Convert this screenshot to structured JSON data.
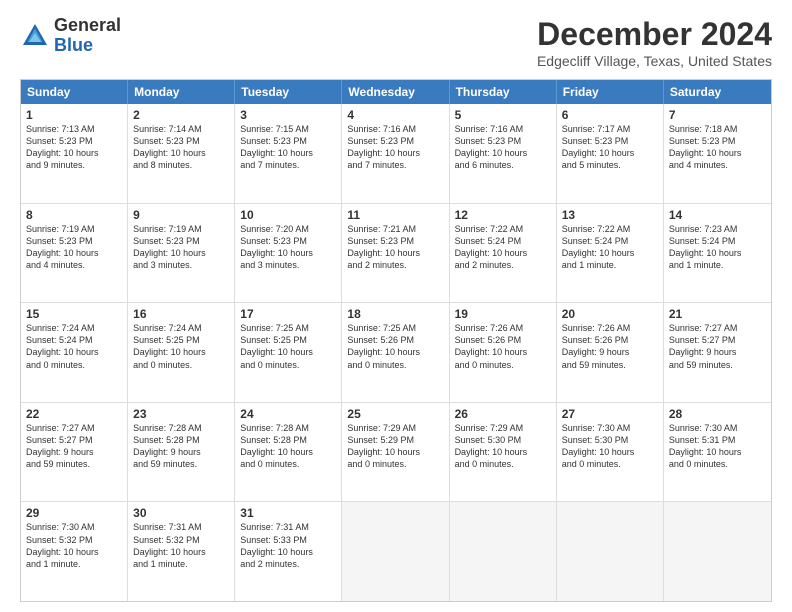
{
  "logo": {
    "general": "General",
    "blue": "Blue"
  },
  "title": "December 2024",
  "subtitle": "Edgecliff Village, Texas, United States",
  "headers": [
    "Sunday",
    "Monday",
    "Tuesday",
    "Wednesday",
    "Thursday",
    "Friday",
    "Saturday"
  ],
  "weeks": [
    [
      {
        "day": "1",
        "info": "Sunrise: 7:13 AM\nSunset: 5:23 PM\nDaylight: 10 hours\nand 9 minutes."
      },
      {
        "day": "2",
        "info": "Sunrise: 7:14 AM\nSunset: 5:23 PM\nDaylight: 10 hours\nand 8 minutes."
      },
      {
        "day": "3",
        "info": "Sunrise: 7:15 AM\nSunset: 5:23 PM\nDaylight: 10 hours\nand 7 minutes."
      },
      {
        "day": "4",
        "info": "Sunrise: 7:16 AM\nSunset: 5:23 PM\nDaylight: 10 hours\nand 7 minutes."
      },
      {
        "day": "5",
        "info": "Sunrise: 7:16 AM\nSunset: 5:23 PM\nDaylight: 10 hours\nand 6 minutes."
      },
      {
        "day": "6",
        "info": "Sunrise: 7:17 AM\nSunset: 5:23 PM\nDaylight: 10 hours\nand 5 minutes."
      },
      {
        "day": "7",
        "info": "Sunrise: 7:18 AM\nSunset: 5:23 PM\nDaylight: 10 hours\nand 4 minutes."
      }
    ],
    [
      {
        "day": "8",
        "info": "Sunrise: 7:19 AM\nSunset: 5:23 PM\nDaylight: 10 hours\nand 4 minutes."
      },
      {
        "day": "9",
        "info": "Sunrise: 7:19 AM\nSunset: 5:23 PM\nDaylight: 10 hours\nand 3 minutes."
      },
      {
        "day": "10",
        "info": "Sunrise: 7:20 AM\nSunset: 5:23 PM\nDaylight: 10 hours\nand 3 minutes."
      },
      {
        "day": "11",
        "info": "Sunrise: 7:21 AM\nSunset: 5:23 PM\nDaylight: 10 hours\nand 2 minutes."
      },
      {
        "day": "12",
        "info": "Sunrise: 7:22 AM\nSunset: 5:24 PM\nDaylight: 10 hours\nand 2 minutes."
      },
      {
        "day": "13",
        "info": "Sunrise: 7:22 AM\nSunset: 5:24 PM\nDaylight: 10 hours\nand 1 minute."
      },
      {
        "day": "14",
        "info": "Sunrise: 7:23 AM\nSunset: 5:24 PM\nDaylight: 10 hours\nand 1 minute."
      }
    ],
    [
      {
        "day": "15",
        "info": "Sunrise: 7:24 AM\nSunset: 5:24 PM\nDaylight: 10 hours\nand 0 minutes."
      },
      {
        "day": "16",
        "info": "Sunrise: 7:24 AM\nSunset: 5:25 PM\nDaylight: 10 hours\nand 0 minutes."
      },
      {
        "day": "17",
        "info": "Sunrise: 7:25 AM\nSunset: 5:25 PM\nDaylight: 10 hours\nand 0 minutes."
      },
      {
        "day": "18",
        "info": "Sunrise: 7:25 AM\nSunset: 5:26 PM\nDaylight: 10 hours\nand 0 minutes."
      },
      {
        "day": "19",
        "info": "Sunrise: 7:26 AM\nSunset: 5:26 PM\nDaylight: 10 hours\nand 0 minutes."
      },
      {
        "day": "20",
        "info": "Sunrise: 7:26 AM\nSunset: 5:26 PM\nDaylight: 9 hours\nand 59 minutes."
      },
      {
        "day": "21",
        "info": "Sunrise: 7:27 AM\nSunset: 5:27 PM\nDaylight: 9 hours\nand 59 minutes."
      }
    ],
    [
      {
        "day": "22",
        "info": "Sunrise: 7:27 AM\nSunset: 5:27 PM\nDaylight: 9 hours\nand 59 minutes."
      },
      {
        "day": "23",
        "info": "Sunrise: 7:28 AM\nSunset: 5:28 PM\nDaylight: 9 hours\nand 59 minutes."
      },
      {
        "day": "24",
        "info": "Sunrise: 7:28 AM\nSunset: 5:28 PM\nDaylight: 10 hours\nand 0 minutes."
      },
      {
        "day": "25",
        "info": "Sunrise: 7:29 AM\nSunset: 5:29 PM\nDaylight: 10 hours\nand 0 minutes."
      },
      {
        "day": "26",
        "info": "Sunrise: 7:29 AM\nSunset: 5:30 PM\nDaylight: 10 hours\nand 0 minutes."
      },
      {
        "day": "27",
        "info": "Sunrise: 7:30 AM\nSunset: 5:30 PM\nDaylight: 10 hours\nand 0 minutes."
      },
      {
        "day": "28",
        "info": "Sunrise: 7:30 AM\nSunset: 5:31 PM\nDaylight: 10 hours\nand 0 minutes."
      }
    ],
    [
      {
        "day": "29",
        "info": "Sunrise: 7:30 AM\nSunset: 5:32 PM\nDaylight: 10 hours\nand 1 minute."
      },
      {
        "day": "30",
        "info": "Sunrise: 7:31 AM\nSunset: 5:32 PM\nDaylight: 10 hours\nand 1 minute."
      },
      {
        "day": "31",
        "info": "Sunrise: 7:31 AM\nSunset: 5:33 PM\nDaylight: 10 hours\nand 2 minutes."
      },
      {
        "day": "",
        "info": ""
      },
      {
        "day": "",
        "info": ""
      },
      {
        "day": "",
        "info": ""
      },
      {
        "day": "",
        "info": ""
      }
    ]
  ]
}
